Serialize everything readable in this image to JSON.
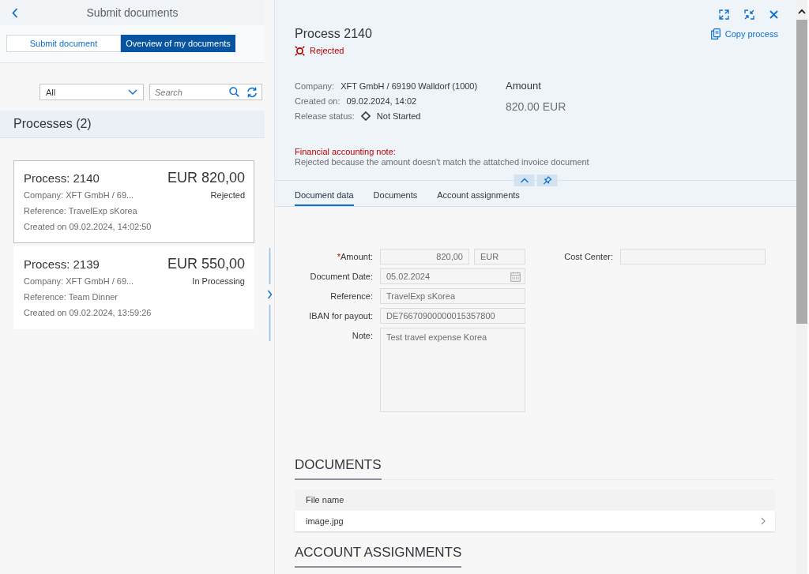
{
  "left_panel": {
    "title": "Submit documents",
    "view_switch": [
      {
        "label": "Submit document",
        "selected": false
      },
      {
        "label": "Overview of my documents",
        "selected": true
      }
    ],
    "filter": {
      "value": "All"
    },
    "search": {
      "placeholder": "Search"
    },
    "list_title": "Processes (2)",
    "processes": [
      {
        "title": "Process: 2140",
        "amount": "EUR 820,00",
        "company": "Company: XFT GmbH / 69...",
        "status": "Rejected",
        "reference": "Reference: TravelExp sKorea",
        "created": "Created on 09.02.2024, 14:02:50",
        "selected": true
      },
      {
        "title": "Process: 2139",
        "amount": "EUR 550,00",
        "company": "Company: XFT GmbH / 69...",
        "status": "In Processing",
        "reference": "Reference: Team Dinner",
        "created": "Created on 09.02.2024, 13:59:26",
        "selected": false
      }
    ]
  },
  "detail": {
    "title": "Process 2140",
    "status": {
      "text": "Rejected",
      "kind": "error"
    },
    "copy_link": "Copy process",
    "header_fields": [
      {
        "label": "Company:",
        "value": "XFT GmbH / 69190 Walldorf (1000)",
        "kind": "text"
      },
      {
        "label": "Created on:",
        "value": "09.02.2024, 14:02",
        "kind": "text"
      },
      {
        "label": "Release status:",
        "value": "Not Started",
        "kind": "status"
      }
    ],
    "amount": {
      "label": "Amount",
      "value": "820.00 EUR"
    },
    "note": {
      "title": "Financial accounting note:",
      "text": "Rejected because the amount doesn't match the attatched invoice document"
    },
    "tabs": [
      {
        "label": "Document data",
        "selected": true
      },
      {
        "label": "Documents",
        "selected": false
      },
      {
        "label": "Account assignments",
        "selected": false
      }
    ],
    "form": {
      "fields": [
        {
          "label": "Amount:",
          "required_mark": "*",
          "kind": "amount",
          "value": "820,00",
          "currency": "EUR"
        },
        {
          "label": "Document Date:",
          "kind": "date",
          "value": "05.02.2024"
        },
        {
          "label": "Reference:",
          "kind": "text",
          "value": "TravelExp sKorea"
        },
        {
          "label": "IBAN for payout:",
          "kind": "text",
          "value": "DE76670900000015357800"
        },
        {
          "label": "Note:",
          "kind": "textarea",
          "value": "Test travel expense Korea"
        }
      ],
      "side_fields": [
        {
          "label": "Cost Center:",
          "kind": "text"
        }
      ]
    },
    "documents": {
      "title": "DOCUMENTS",
      "columns": [
        "File name"
      ],
      "rows": [
        [
          "image.jpg"
        ]
      ]
    },
    "account_assignments": {
      "title": "ACCOUNT ASSIGNMENTS"
    }
  }
}
